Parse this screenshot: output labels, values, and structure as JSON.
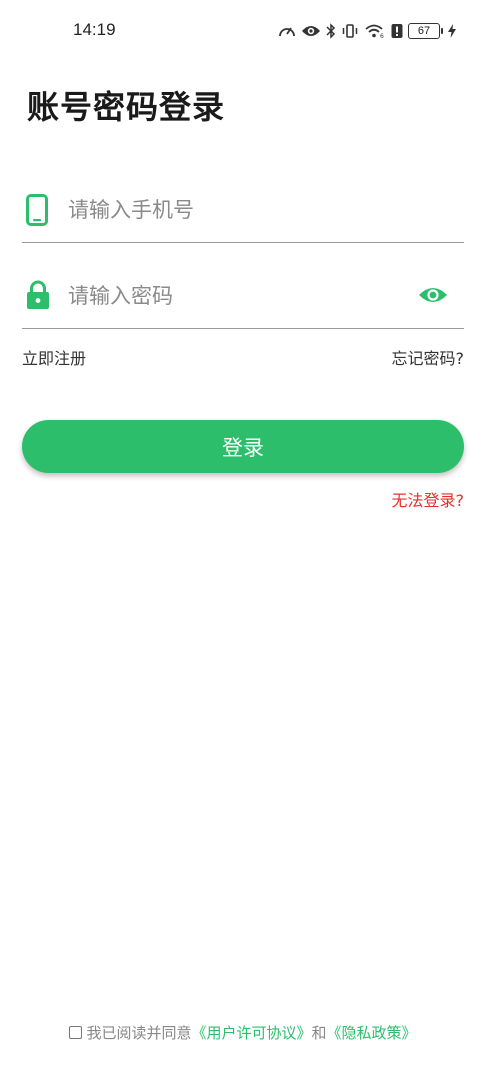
{
  "status_bar": {
    "time": "14:19",
    "battery": "67"
  },
  "page": {
    "title": "账号密码登录"
  },
  "phone_field": {
    "placeholder": "请输入手机号",
    "value": ""
  },
  "password_field": {
    "placeholder": "请输入密码",
    "value": ""
  },
  "links": {
    "register": "立即注册",
    "forgot_password": "忘记密码?",
    "cant_login": "无法登录?"
  },
  "login_button": {
    "label": "登录"
  },
  "agreement": {
    "prefix": "我已阅读并同意",
    "user_agreement": "《用户许可协议》",
    "connector": "和",
    "privacy_policy": "《隐私政策》",
    "checked": false
  },
  "colors": {
    "accent": "#2dbe6c",
    "warning": "#e0322b"
  }
}
